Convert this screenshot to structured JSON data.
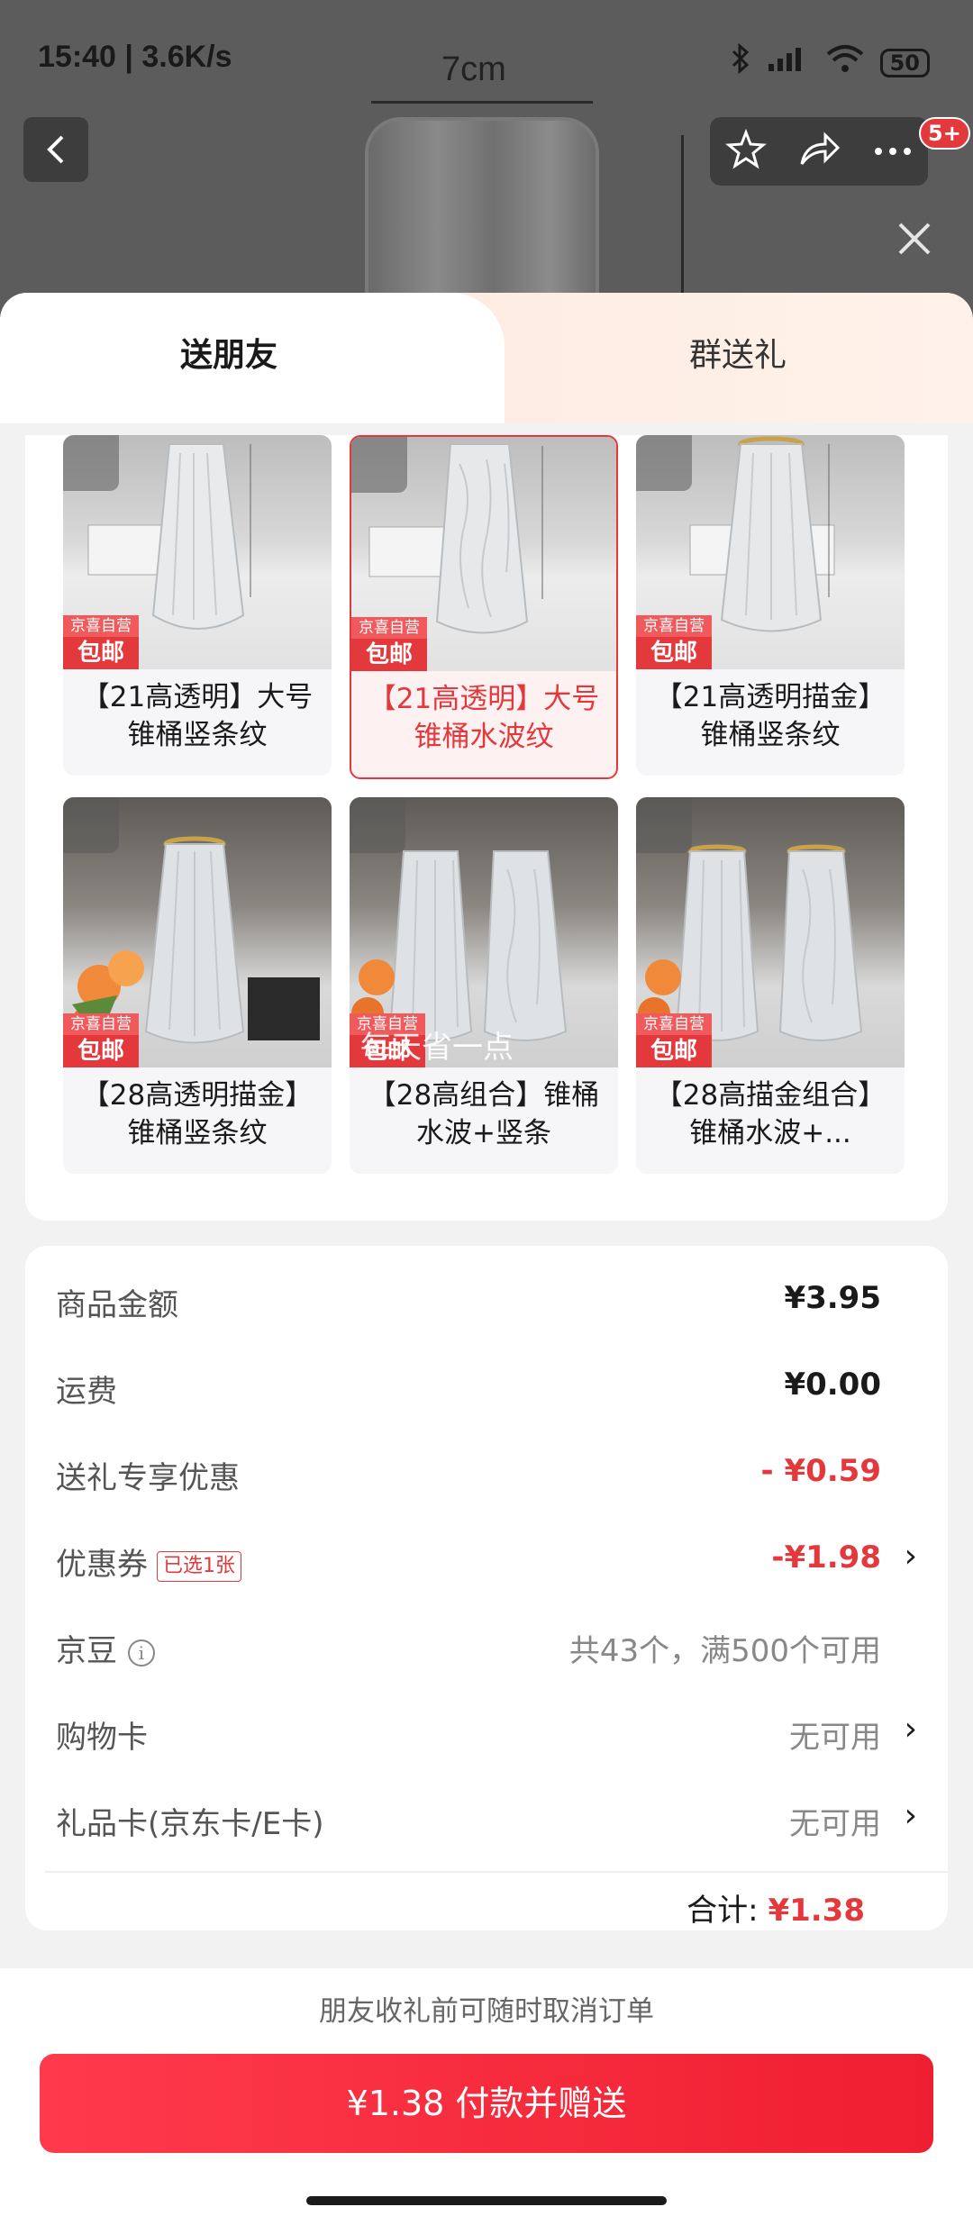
{
  "status": {
    "time_speed": "15:40 | 3.6K/s",
    "battery": "50"
  },
  "background": {
    "dimension": "7cm",
    "badge": "5+"
  },
  "tabs": [
    {
      "label": "送朋友"
    },
    {
      "label": "群送礼"
    }
  ],
  "badge": {
    "line1": "京喜自营",
    "line2": "包邮"
  },
  "variants": [
    {
      "label": "【21高透明】大号锥桶竖条纹",
      "selected": false
    },
    {
      "label": "【21高透明】大号锥桶水波纹",
      "selected": true
    },
    {
      "label": "【21高透明描金】锥桶竖条纹",
      "selected": false
    },
    {
      "label": "【28高透明描金】锥桶竖条纹",
      "selected": false
    },
    {
      "label": "【28高组合】锥桶水波+竖条",
      "selected": false
    },
    {
      "label": "【28高描金组合】锥桶水波+...",
      "selected": false
    }
  ],
  "watermark": "每天省一点",
  "summary": {
    "goods_label": "商品金额",
    "goods_value": "¥3.95",
    "shipping_label": "运费",
    "shipping_value": "¥0.00",
    "gift_discount_label": "送礼专享优惠",
    "gift_discount_value": "- ¥0.59",
    "coupon_label": "优惠券",
    "coupon_tag": "已选1张",
    "coupon_value": "-¥1.98",
    "beans_label": "京豆",
    "beans_value": "共43个，满500个可用",
    "shopping_card_label": "购物卡",
    "shopping_card_value": "无可用",
    "gift_card_label": "礼品卡(京东卡/E卡)",
    "gift_card_value": "无可用",
    "total_label": "合计:",
    "total_value": "¥1.38"
  },
  "footer": {
    "note": "朋友收礼前可随时取消订单",
    "pay_button": "¥1.38 付款并赠送"
  },
  "colors": {
    "accent": "#e4393c"
  }
}
